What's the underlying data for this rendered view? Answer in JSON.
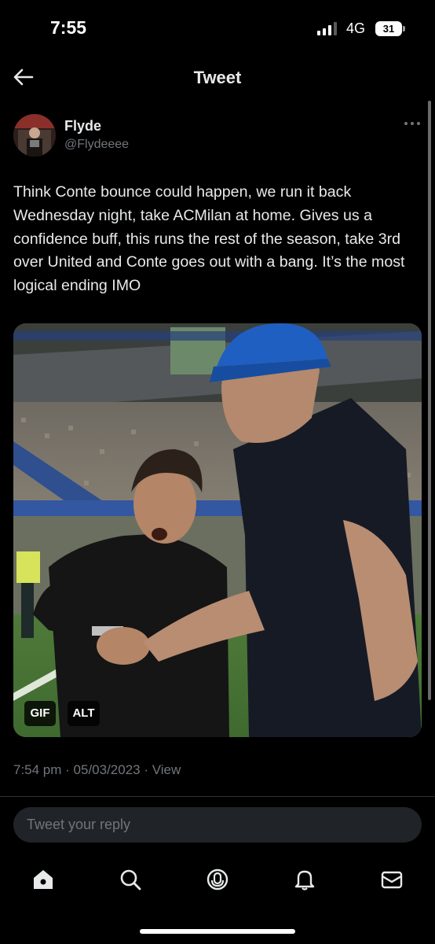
{
  "status_bar": {
    "time": "7:55",
    "network": "4G",
    "battery": "31"
  },
  "header": {
    "title": "Tweet",
    "back_icon": "arrow-left-icon"
  },
  "tweet": {
    "display_name": "Flyde",
    "handle": "@Flydeeee",
    "text": "Think Conte bounce could happen, we run it back Wednesday night, take ACMilan at home. Gives us a confidence buff, this runs the rest of the season, take 3rd over United and Conte goes out with a bang. It’s the most logical ending IMO",
    "media": {
      "badges": [
        "GIF",
        "ALT"
      ]
    },
    "time": "7:54 pm",
    "date": "05/03/2023",
    "views_label": "View"
  },
  "reply": {
    "placeholder": "Tweet your reply"
  },
  "tab_bar": {
    "items": [
      {
        "name": "home",
        "icon": "home-icon"
      },
      {
        "name": "search",
        "icon": "search-icon"
      },
      {
        "name": "spaces",
        "icon": "microphone-icon"
      },
      {
        "name": "notifications",
        "icon": "bell-icon"
      },
      {
        "name": "messages",
        "icon": "envelope-icon"
      }
    ]
  },
  "colors": {
    "background": "#000000",
    "text_primary": "#e7e9ea",
    "text_secondary": "#71767b",
    "reply_field": "#202327",
    "divider": "#2f3336"
  }
}
